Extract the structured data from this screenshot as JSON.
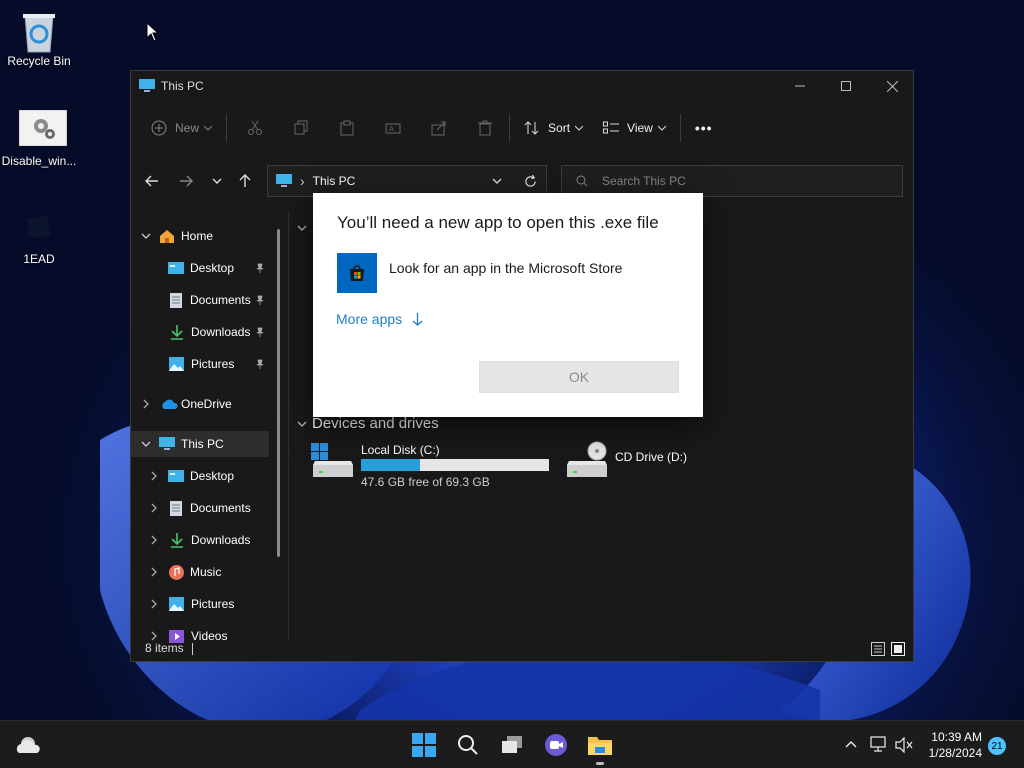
{
  "desktop": {
    "icons": [
      {
        "label": "Recycle Bin"
      },
      {
        "label": "Disable_win..."
      },
      {
        "label": "1EAD"
      }
    ]
  },
  "explorer": {
    "title": "This PC",
    "toolbar": {
      "new_label": "New",
      "sort_label": "Sort",
      "view_label": "View",
      "more_label": "•••"
    },
    "address": {
      "separator": "›",
      "location": "This PC"
    },
    "search": {
      "placeholder": "Search This PC"
    },
    "nav": {
      "items": [
        {
          "label": "Home"
        },
        {
          "label": "Desktop"
        },
        {
          "label": "Documents"
        },
        {
          "label": "Downloads"
        },
        {
          "label": "Pictures"
        },
        {
          "label": "OneDrive"
        },
        {
          "label": "This PC"
        },
        {
          "label": "Desktop"
        },
        {
          "label": "Documents"
        },
        {
          "label": "Downloads"
        },
        {
          "label": "Music"
        },
        {
          "label": "Pictures"
        },
        {
          "label": "Videos"
        }
      ]
    },
    "devices": {
      "header": "Devices and drives",
      "drives": [
        {
          "name": "Local Disk (C:)",
          "free_text": "47.6 GB free of 69.3 GB",
          "used_fraction": 0.313
        },
        {
          "name": "CD Drive (D:)"
        }
      ]
    },
    "status": {
      "items_count": "8 items"
    }
  },
  "dialog": {
    "title": "You’ll need a new app to open this .exe file",
    "store_option": "Look for an app in the Microsoft Store",
    "more_apps": "More apps",
    "ok_label": "OK"
  },
  "taskbar": {
    "time": "10:39 AM",
    "date": "1/28/2024",
    "notification_count": "21"
  },
  "colors": {
    "accent": "#0067c0",
    "drive_bar": "#26a0da",
    "link": "#1d7fc4"
  }
}
